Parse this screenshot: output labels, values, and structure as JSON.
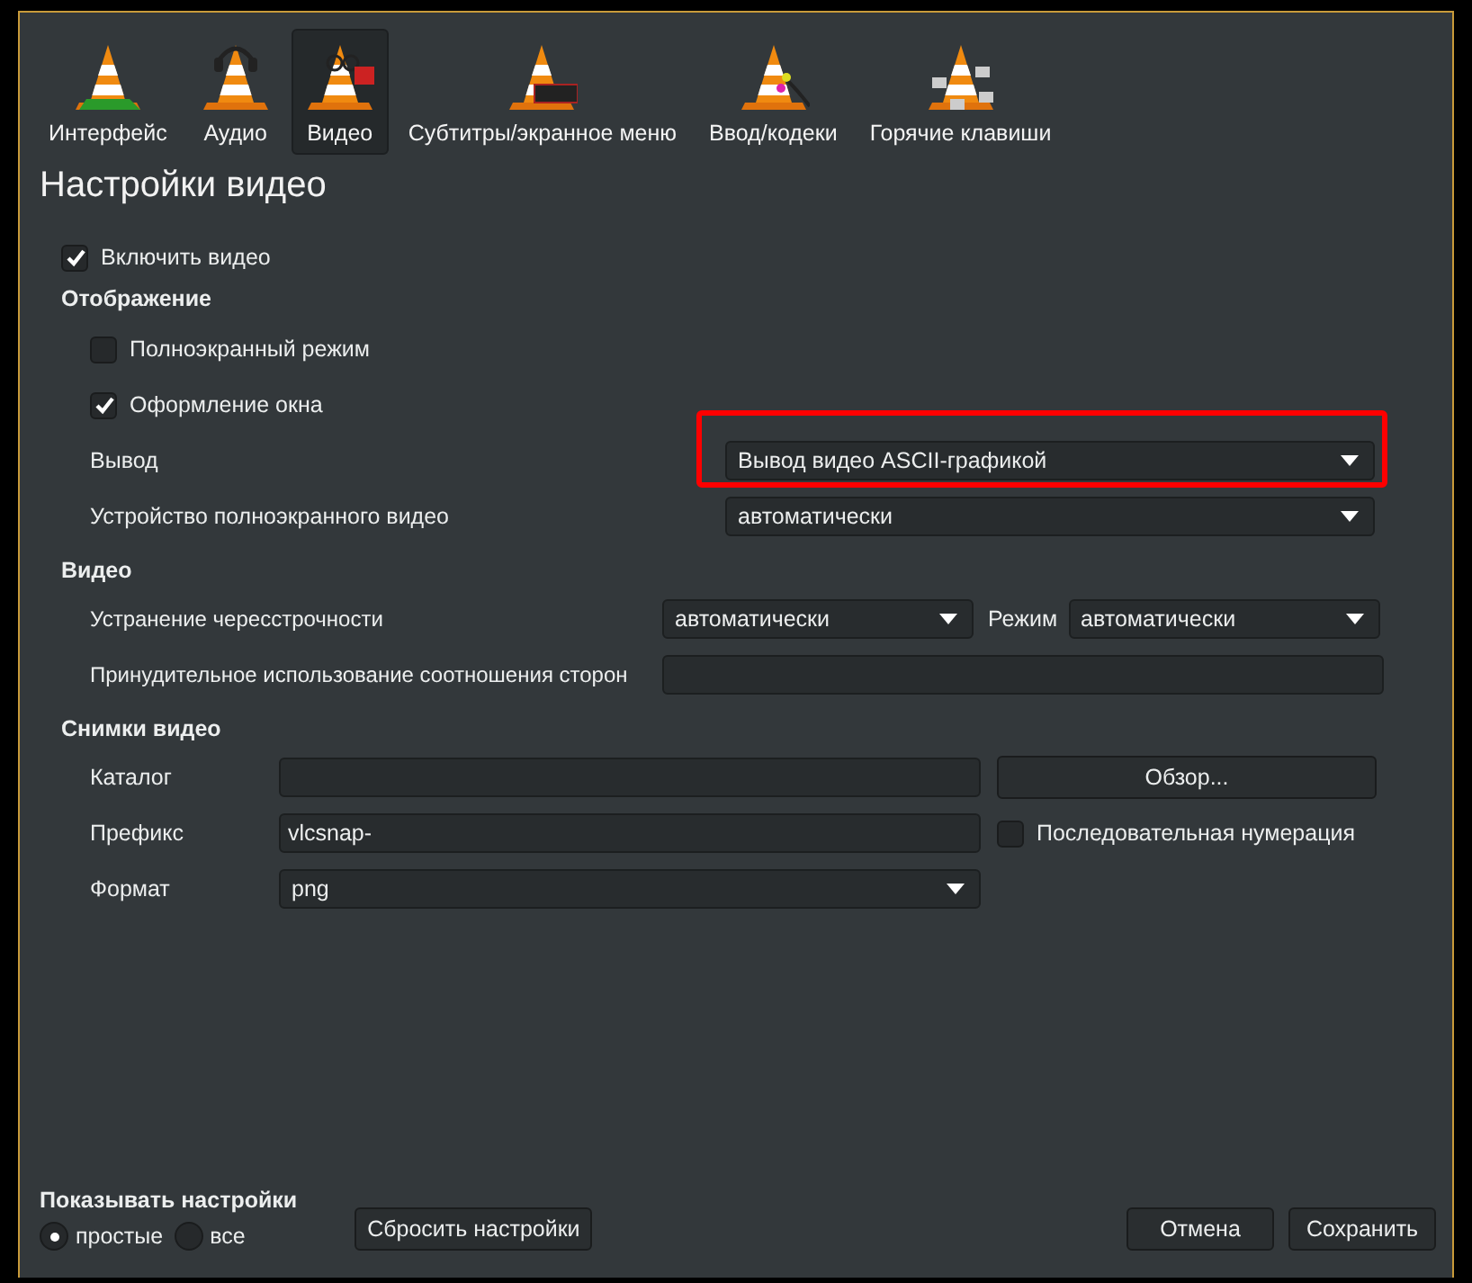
{
  "tabs": [
    {
      "label": "Интерфейс",
      "kind": "interface",
      "selected": false
    },
    {
      "label": "Аудио",
      "kind": "audio",
      "selected": false
    },
    {
      "label": "Видео",
      "kind": "video",
      "selected": true
    },
    {
      "label": "Субтитры/экранное меню",
      "kind": "subtitles",
      "selected": false
    },
    {
      "label": "Ввод/кодеки",
      "kind": "input",
      "selected": false
    },
    {
      "label": "Горячие клавиши",
      "kind": "hotkeys",
      "selected": false
    }
  ],
  "title": "Настройки видео",
  "enable_video": {
    "label": "Включить видео",
    "checked": true
  },
  "sections": [
    {
      "heading": "Отображение",
      "kind": "display",
      "rows": [
        {
          "kind": "checkbox",
          "label": "Полноэкранный режим",
          "checked": false
        },
        {
          "kind": "checkbox",
          "label": "Оформление окна",
          "checked": true
        },
        {
          "kind": "combo",
          "label": "Вывод",
          "value": "Вывод видео ASCII-графикой",
          "highlighted": true
        },
        {
          "kind": "combo",
          "label": "Устройство полноэкранного видео",
          "value": "автоматически",
          "highlighted": false
        }
      ]
    },
    {
      "heading": "Видео",
      "kind": "video",
      "rows": [
        {
          "kind": "combo_pair",
          "label": "Устранение чересстрочности",
          "value": "автоматически",
          "mode_label": "Режим",
          "mode_value": "автоматически"
        },
        {
          "kind": "field",
          "label": "Принудительное использование соотношения сторон"
        }
      ]
    },
    {
      "heading": "Снимки видео",
      "kind": "snapshots",
      "rows": [
        {
          "kind": "field_button",
          "label": "Каталог",
          "button": "Обзор..."
        },
        {
          "kind": "field_check",
          "label": "Префикс",
          "value": "vlcsnap-",
          "check_label": "Последовательная нумерация",
          "checked": false
        },
        {
          "kind": "combo",
          "label": "Формат",
          "value": "png",
          "highlighted": false
        }
      ]
    }
  ],
  "show_settings": {
    "label": "Показывать настройки",
    "options": [
      {
        "label": "простые",
        "selected": true
      },
      {
        "label": "все",
        "selected": false
      }
    ]
  },
  "reset_button": "Сбросить настройки",
  "buttons": [
    "Отмена",
    "Сохранить"
  ]
}
